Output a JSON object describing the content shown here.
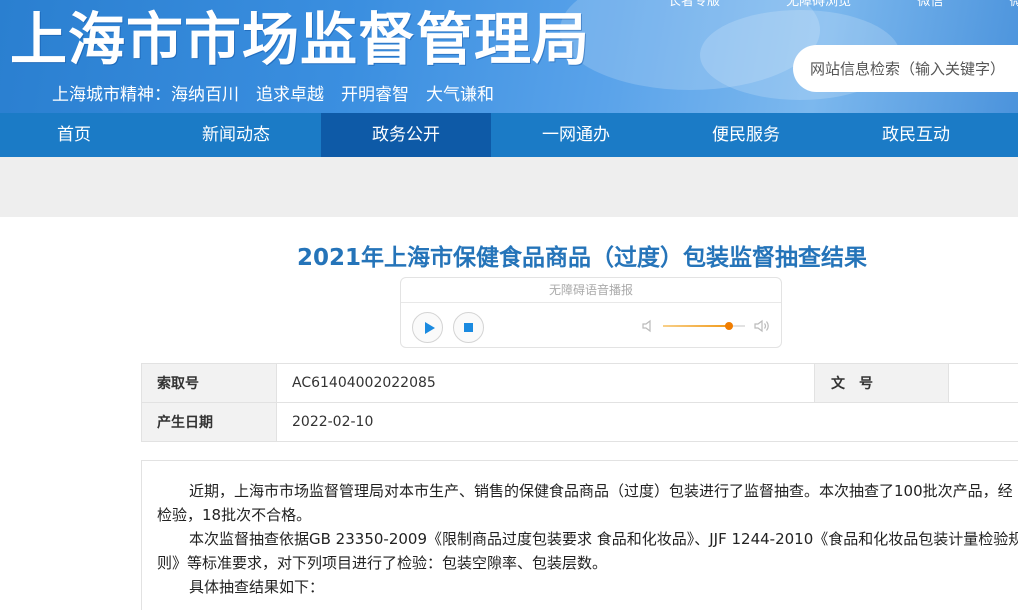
{
  "header": {
    "site_title": "上海市市场监督管理局",
    "slogan": "上海城市精神：海纳百川　追求卓越　开明睿智　大气谦和",
    "top_links": [
      "长者专版",
      "无障碍浏览",
      "微信",
      "微博"
    ],
    "search_placeholder": "网站信息检索（输入关键字）"
  },
  "nav": {
    "items": [
      "首页",
      "新闻动态",
      "政务公开",
      "一网通办",
      "便民服务",
      "政民互动"
    ],
    "active": "政务公开"
  },
  "article": {
    "title": "2021年上海市保健食品商品（过度）包装监督抽查结果"
  },
  "player": {
    "title": "无障碍语音播报",
    "volume": 0.8
  },
  "meta": {
    "index_label": "索取号",
    "index_value": "AC61404002022085",
    "docno_label": "文　号",
    "docno_value": "",
    "date_label": "产生日期",
    "date_value": "2022-02-10"
  },
  "body": {
    "paragraphs": [
      "近期，上海市市场监督管理局对本市生产、销售的保健食品商品（过度）包装进行了监督抽查。本次抽查了100批次产品，经检验，18批次不合格。",
      "本次监督抽查依据GB 23350-2009《限制商品过度包装要求 食品和化妆品》、JJF 1244-2010《食品和化妆品包装计量检验规则》等标准要求，对下列项目进行了检验：包装空隙率、包装层数。",
      "具体抽查结果如下："
    ]
  },
  "colors": {
    "nav_bg": "#1b7bc6",
    "nav_active": "#0e5aa7",
    "title_blue": "#2574b9",
    "volume_accent": "#f07d00"
  }
}
